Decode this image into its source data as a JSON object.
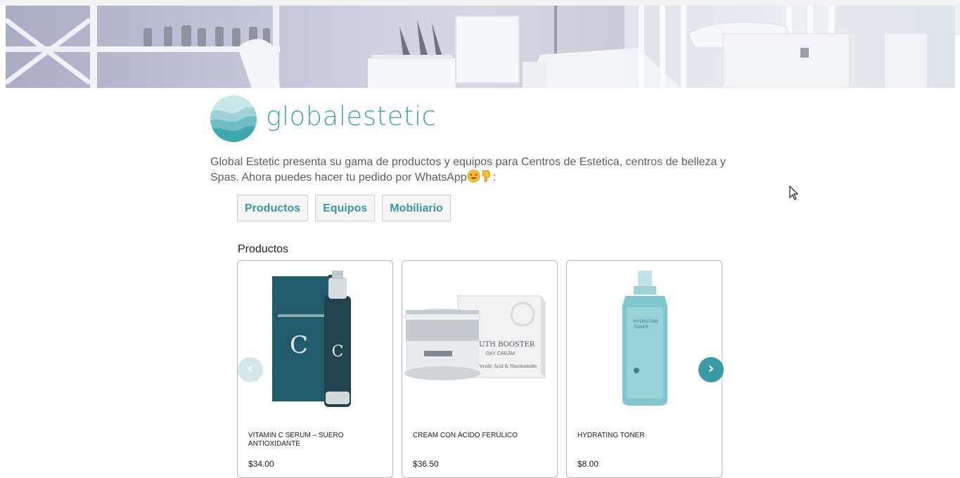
{
  "brand": {
    "name": "globalestetic",
    "accent": "#3fa7b0"
  },
  "intro": {
    "text": "Global Estetic presenta su gama de productos y equipos para Centros de Estetica, centros de belleza y Spas. Ahora puedes hacer tu pedido por WhatsApp",
    "suffix": ":"
  },
  "tabs": [
    {
      "label": "Productos"
    },
    {
      "label": "Equipos"
    },
    {
      "label": "Mobiliario"
    }
  ],
  "section": {
    "title": "Productos"
  },
  "products": [
    {
      "name": "VITAMIN C SERUM – SUERO ANTIOXIDANTE",
      "price": "$34.00",
      "icon": "serum-bottle-image"
    },
    {
      "name": "CREAM CON ÁCIDO FERÚLICO",
      "price": "$36.50",
      "icon": "cream-jar-image"
    },
    {
      "name": "HYDRATING TONER",
      "price": "$8.00",
      "icon": "toner-spray-image"
    }
  ],
  "carousel": {
    "prev": "‹",
    "next": "›"
  }
}
